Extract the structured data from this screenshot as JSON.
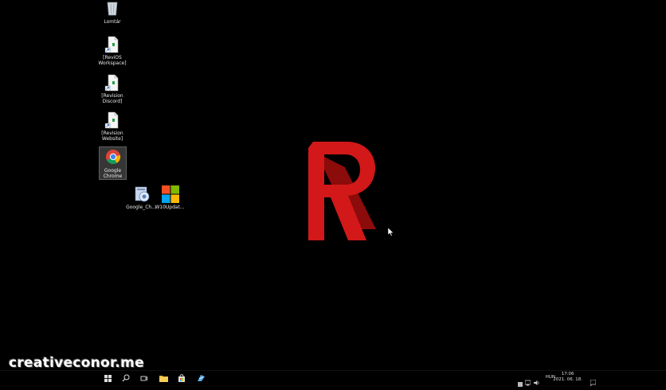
{
  "desktop": {
    "icons": [
      {
        "label": "Lomtár",
        "icon": "recycle-bin-icon"
      },
      {
        "label": "[ReviOS Workspace]",
        "icon": "shortcut-icon"
      },
      {
        "label": "[Revision Discord]",
        "icon": "shortcut-icon"
      },
      {
        "label": "[Revision Website]",
        "icon": "shortcut-icon"
      },
      {
        "label": "Google Chrome",
        "icon": "chrome-icon"
      },
      {
        "label": "Google_Ch...",
        "icon": "installer-icon"
      },
      {
        "label": "W10Updat...",
        "icon": "windows-logo-icon"
      }
    ]
  },
  "wallpaper": {
    "logo_color": "#d21818",
    "logo_shadow_color": "#8c0b0b"
  },
  "watermark": "creativeconor.me",
  "taskbar": {
    "buttons": [
      "start-icon",
      "search-icon",
      "task-view-icon",
      "file-explorer-icon",
      "store-icon",
      "app-icon"
    ],
    "tray": {
      "language": "HUN",
      "time": "17:06",
      "date": "2021. 06. 18."
    }
  }
}
